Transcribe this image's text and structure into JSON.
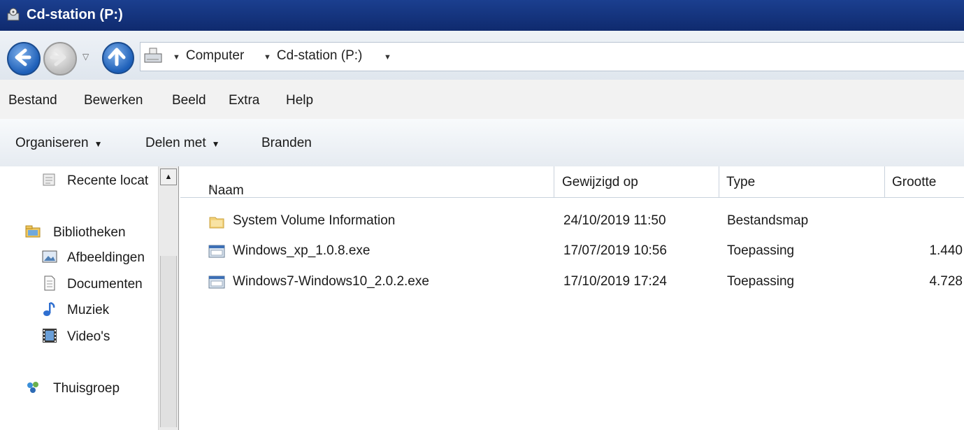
{
  "window": {
    "title": "Cd-station (P:)",
    "icon": "drive-icon"
  },
  "address_bar": {
    "icons": {
      "back": "back-arrow-icon",
      "forward": "forward-arrow-icon",
      "up": "up-arrow-icon",
      "location": "drive-icon"
    },
    "breadcrumbs": [
      "Computer",
      "Cd-station (P:)"
    ]
  },
  "menu": [
    "Bestand",
    "Bewerken",
    "Beeld",
    "Extra",
    "Help"
  ],
  "toolbar": {
    "organize": "Organiseren",
    "share": "Delen met",
    "burn": "Branden"
  },
  "sidebar": {
    "recent": "Recente locat",
    "libraries": "Bibliotheken",
    "library_items": [
      "Afbeeldingen",
      "Documenten",
      "Muziek",
      "Video's"
    ],
    "homegroup": "Thuisgroep"
  },
  "columns": {
    "name": "Naam",
    "modified": "Gewijzigd op",
    "type": "Type",
    "size": "Grootte"
  },
  "files": [
    {
      "name": "System Volume Information",
      "modified": "24/10/2019 11:50",
      "type": "Bestandsmap",
      "size": "",
      "icon": "folder-icon"
    },
    {
      "name": "Windows_xp_1.0.8.exe",
      "modified": "17/07/2019 10:56",
      "type": "Toepassing",
      "size": "1.440",
      "icon": "application-icon"
    },
    {
      "name": "Windows7-Windows10_2.0.2.exe",
      "modified": "17/10/2019 17:24",
      "type": "Toepassing",
      "size": "4.728",
      "icon": "application-icon"
    }
  ],
  "colors": {
    "titlebar": "#1b3f8f",
    "accent": "#1d5fb8"
  }
}
